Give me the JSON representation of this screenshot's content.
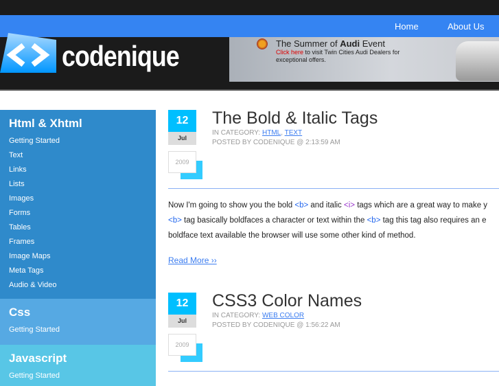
{
  "nav": {
    "items": [
      "Home",
      "About Us"
    ]
  },
  "logo": {
    "text": "codenique"
  },
  "banner": {
    "title_pre": "The Summer of ",
    "title_brand": "Audi",
    "title_post": " Event",
    "click": "Click here",
    "rest": " to visit Twin Cities Audi Dealers for exceptional offers."
  },
  "sidebar": [
    {
      "title": "Html & Xhtml",
      "items": [
        "Getting Started",
        "Text",
        "Links",
        "Lists",
        "Images",
        "Forms",
        "Tables",
        "Frames",
        "Image Maps",
        "Meta Tags",
        "Audio & Video"
      ]
    },
    {
      "title": "Css",
      "items": [
        "Getting Started"
      ]
    },
    {
      "title": "Javascript",
      "items": [
        "Getting Started"
      ]
    }
  ],
  "posts": [
    {
      "day": "12",
      "month": "Jul",
      "year": "2009",
      "title": "The Bold & Italic Tags",
      "category_label": "IN CATEGORY: ",
      "categories": [
        "HTML",
        "TEXT"
      ],
      "posted": "POSTED BY CODENIQUE @ 2:13:59 AM",
      "body": {
        "l1a": "Now I'm going to show you the bold ",
        "b": "<b>",
        "l1b": " and italic ",
        "i": "<i>",
        "l1c": " tags which are a great way to make y",
        "l2a": " tag basically boldfaces a character or text within the ",
        "l2b": " tag this tag also requires an e",
        "l3": "boldface text available the browser will use some other kind of method."
      },
      "read_more": "Read More ››"
    },
    {
      "day": "12",
      "month": "Jul",
      "year": "2009",
      "title": "CSS3 Color Names",
      "category_label": "IN CATEGORY: ",
      "categories": [
        "WEB COLOR"
      ],
      "posted": "POSTED BY CODENIQUE @ 1:56:22 AM"
    }
  ]
}
